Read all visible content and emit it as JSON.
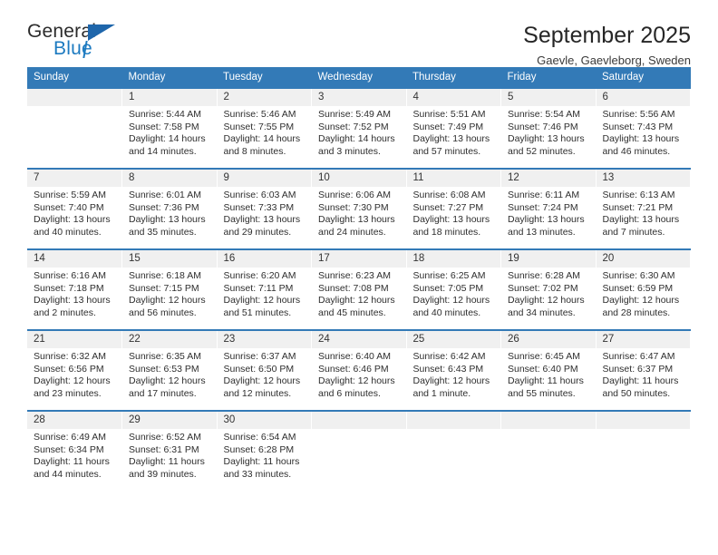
{
  "brand": {
    "name_top": "General",
    "name_bottom": "Blue",
    "accent_color": "#1e66ab",
    "logo_icon": "triangle-logo-icon"
  },
  "header": {
    "title": "September 2025",
    "subtitle": "Gaevle, Gaevleborg, Sweden"
  },
  "calendar": {
    "header_bg": "#337ab7",
    "daynum_bg": "#f0f0f0",
    "weekdays": [
      "Sunday",
      "Monday",
      "Tuesday",
      "Wednesday",
      "Thursday",
      "Friday",
      "Saturday"
    ],
    "weeks": [
      [
        {
          "day": "",
          "lines": []
        },
        {
          "day": "1",
          "lines": [
            "Sunrise: 5:44 AM",
            "Sunset: 7:58 PM",
            "Daylight: 14 hours",
            "and 14 minutes."
          ]
        },
        {
          "day": "2",
          "lines": [
            "Sunrise: 5:46 AM",
            "Sunset: 7:55 PM",
            "Daylight: 14 hours",
            "and 8 minutes."
          ]
        },
        {
          "day": "3",
          "lines": [
            "Sunrise: 5:49 AM",
            "Sunset: 7:52 PM",
            "Daylight: 14 hours",
            "and 3 minutes."
          ]
        },
        {
          "day": "4",
          "lines": [
            "Sunrise: 5:51 AM",
            "Sunset: 7:49 PM",
            "Daylight: 13 hours",
            "and 57 minutes."
          ]
        },
        {
          "day": "5",
          "lines": [
            "Sunrise: 5:54 AM",
            "Sunset: 7:46 PM",
            "Daylight: 13 hours",
            "and 52 minutes."
          ]
        },
        {
          "day": "6",
          "lines": [
            "Sunrise: 5:56 AM",
            "Sunset: 7:43 PM",
            "Daylight: 13 hours",
            "and 46 minutes."
          ]
        }
      ],
      [
        {
          "day": "7",
          "lines": [
            "Sunrise: 5:59 AM",
            "Sunset: 7:40 PM",
            "Daylight: 13 hours",
            "and 40 minutes."
          ]
        },
        {
          "day": "8",
          "lines": [
            "Sunrise: 6:01 AM",
            "Sunset: 7:36 PM",
            "Daylight: 13 hours",
            "and 35 minutes."
          ]
        },
        {
          "day": "9",
          "lines": [
            "Sunrise: 6:03 AM",
            "Sunset: 7:33 PM",
            "Daylight: 13 hours",
            "and 29 minutes."
          ]
        },
        {
          "day": "10",
          "lines": [
            "Sunrise: 6:06 AM",
            "Sunset: 7:30 PM",
            "Daylight: 13 hours",
            "and 24 minutes."
          ]
        },
        {
          "day": "11",
          "lines": [
            "Sunrise: 6:08 AM",
            "Sunset: 7:27 PM",
            "Daylight: 13 hours",
            "and 18 minutes."
          ]
        },
        {
          "day": "12",
          "lines": [
            "Sunrise: 6:11 AM",
            "Sunset: 7:24 PM",
            "Daylight: 13 hours",
            "and 13 minutes."
          ]
        },
        {
          "day": "13",
          "lines": [
            "Sunrise: 6:13 AM",
            "Sunset: 7:21 PM",
            "Daylight: 13 hours",
            "and 7 minutes."
          ]
        }
      ],
      [
        {
          "day": "14",
          "lines": [
            "Sunrise: 6:16 AM",
            "Sunset: 7:18 PM",
            "Daylight: 13 hours",
            "and 2 minutes."
          ]
        },
        {
          "day": "15",
          "lines": [
            "Sunrise: 6:18 AM",
            "Sunset: 7:15 PM",
            "Daylight: 12 hours",
            "and 56 minutes."
          ]
        },
        {
          "day": "16",
          "lines": [
            "Sunrise: 6:20 AM",
            "Sunset: 7:11 PM",
            "Daylight: 12 hours",
            "and 51 minutes."
          ]
        },
        {
          "day": "17",
          "lines": [
            "Sunrise: 6:23 AM",
            "Sunset: 7:08 PM",
            "Daylight: 12 hours",
            "and 45 minutes."
          ]
        },
        {
          "day": "18",
          "lines": [
            "Sunrise: 6:25 AM",
            "Sunset: 7:05 PM",
            "Daylight: 12 hours",
            "and 40 minutes."
          ]
        },
        {
          "day": "19",
          "lines": [
            "Sunrise: 6:28 AM",
            "Sunset: 7:02 PM",
            "Daylight: 12 hours",
            "and 34 minutes."
          ]
        },
        {
          "day": "20",
          "lines": [
            "Sunrise: 6:30 AM",
            "Sunset: 6:59 PM",
            "Daylight: 12 hours",
            "and 28 minutes."
          ]
        }
      ],
      [
        {
          "day": "21",
          "lines": [
            "Sunrise: 6:32 AM",
            "Sunset: 6:56 PM",
            "Daylight: 12 hours",
            "and 23 minutes."
          ]
        },
        {
          "day": "22",
          "lines": [
            "Sunrise: 6:35 AM",
            "Sunset: 6:53 PM",
            "Daylight: 12 hours",
            "and 17 minutes."
          ]
        },
        {
          "day": "23",
          "lines": [
            "Sunrise: 6:37 AM",
            "Sunset: 6:50 PM",
            "Daylight: 12 hours",
            "and 12 minutes."
          ]
        },
        {
          "day": "24",
          "lines": [
            "Sunrise: 6:40 AM",
            "Sunset: 6:46 PM",
            "Daylight: 12 hours",
            "and 6 minutes."
          ]
        },
        {
          "day": "25",
          "lines": [
            "Sunrise: 6:42 AM",
            "Sunset: 6:43 PM",
            "Daylight: 12 hours",
            "and 1 minute."
          ]
        },
        {
          "day": "26",
          "lines": [
            "Sunrise: 6:45 AM",
            "Sunset: 6:40 PM",
            "Daylight: 11 hours",
            "and 55 minutes."
          ]
        },
        {
          "day": "27",
          "lines": [
            "Sunrise: 6:47 AM",
            "Sunset: 6:37 PM",
            "Daylight: 11 hours",
            "and 50 minutes."
          ]
        }
      ],
      [
        {
          "day": "28",
          "lines": [
            "Sunrise: 6:49 AM",
            "Sunset: 6:34 PM",
            "Daylight: 11 hours",
            "and 44 minutes."
          ]
        },
        {
          "day": "29",
          "lines": [
            "Sunrise: 6:52 AM",
            "Sunset: 6:31 PM",
            "Daylight: 11 hours",
            "and 39 minutes."
          ]
        },
        {
          "day": "30",
          "lines": [
            "Sunrise: 6:54 AM",
            "Sunset: 6:28 PM",
            "Daylight: 11 hours",
            "and 33 minutes."
          ]
        },
        {
          "day": "",
          "lines": []
        },
        {
          "day": "",
          "lines": []
        },
        {
          "day": "",
          "lines": []
        },
        {
          "day": "",
          "lines": []
        }
      ]
    ]
  }
}
